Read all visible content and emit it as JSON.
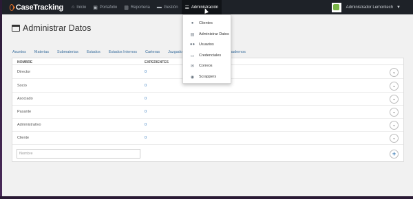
{
  "brand": {
    "name": "CaseTracking"
  },
  "nav": {
    "items": [
      {
        "label": "Inicio",
        "icon": "home-icon"
      },
      {
        "label": "Portafolio",
        "icon": "briefcase-icon"
      },
      {
        "label": "Reporteria",
        "icon": "chart-icon"
      },
      {
        "label": "Gestión",
        "icon": "folder-icon"
      },
      {
        "label": "Administración",
        "icon": "menu-icon"
      }
    ],
    "user": "Administrador Lemontech"
  },
  "page": {
    "title": "Administrar Datos"
  },
  "tabs": [
    "Asuntos",
    "Materias",
    "Submaterias",
    "Estados",
    "Estados Internos",
    "Carteras",
    "Juzgados",
    "Cuadernos"
  ],
  "table": {
    "headers": {
      "name": "NOMBRE",
      "expedientes": "EXPEDIENTES"
    },
    "rows": [
      {
        "name": "Director",
        "expedientes": "0"
      },
      {
        "name": "Socio",
        "expedientes": "0"
      },
      {
        "name": "Asociado",
        "expedientes": "0"
      },
      {
        "name": "Pasante",
        "expedientes": "0"
      },
      {
        "name": "Administrativo",
        "expedientes": "0"
      },
      {
        "name": "Cliente",
        "expedientes": "0"
      }
    ],
    "new_placeholder": "Nombre"
  },
  "dropdown": {
    "items": [
      {
        "label": "Clientes",
        "icon": "user-icon"
      },
      {
        "label": "Administrar Datos",
        "icon": "table-icon"
      },
      {
        "label": "Usuarios",
        "icon": "users-icon"
      },
      {
        "label": "Credenciales",
        "icon": "id-card-icon"
      },
      {
        "label": "Correos",
        "icon": "envelope-icon"
      },
      {
        "label": "Scrappers",
        "icon": "eye-icon"
      }
    ]
  },
  "colors": {
    "navbar": "#1e2228",
    "accent": "#e8742b",
    "link": "#3a6f9e"
  }
}
